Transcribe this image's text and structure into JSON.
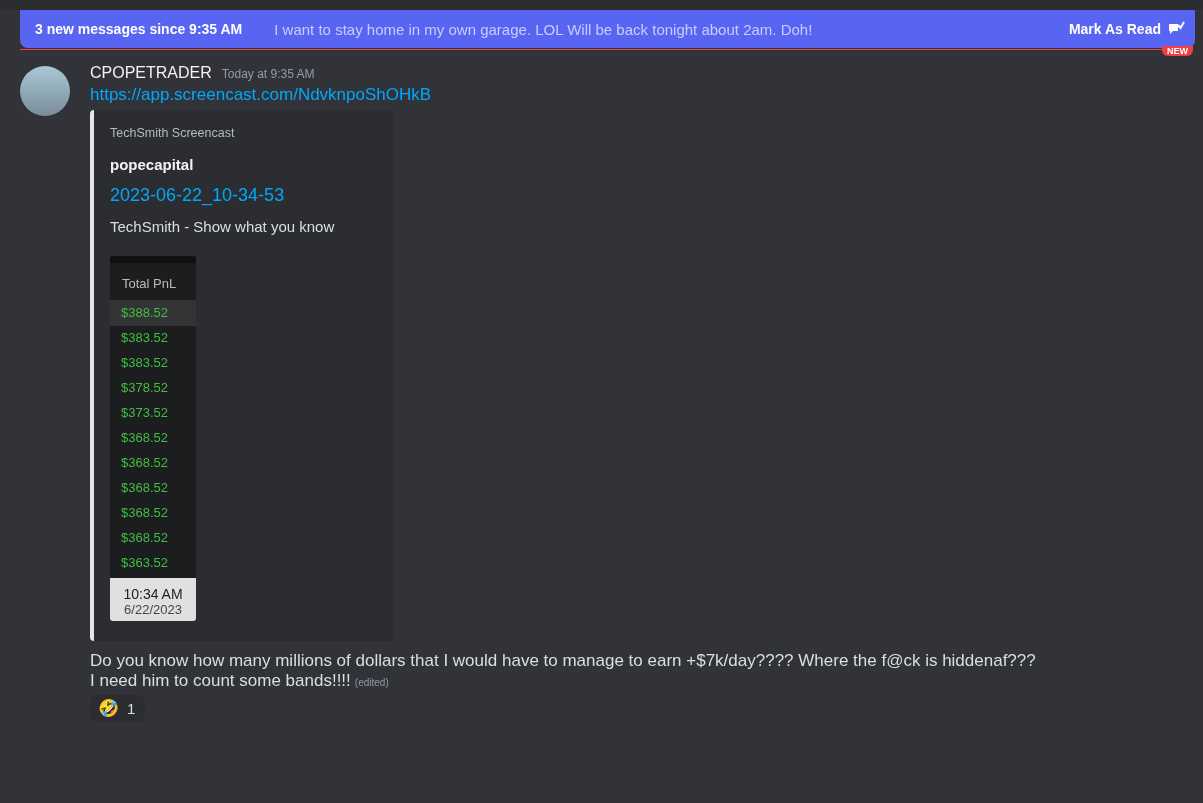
{
  "banner": {
    "text": "3 new messages since 9:35 AM",
    "hidden_message": "I want to stay home in my own garage.   LOL Will be back tonight about 2am.  Doh!",
    "action": "Mark As Read"
  },
  "divider": {
    "badge": "NEW"
  },
  "message": {
    "author": "CPOPETRADER",
    "timestamp": "Today at 9:35 AM",
    "link": "https://app.screencast.com/NdvknpoShOHkB",
    "embed": {
      "provider": "TechSmith Screencast",
      "author": "popecapital",
      "title": "2023-06-22_10-34-53",
      "description": "TechSmith - Show what you know",
      "thumbnail": {
        "column": "Total PnL",
        "rows": [
          {
            "value": "$388.52",
            "selected": true
          },
          {
            "value": "$383.52",
            "selected": false
          },
          {
            "value": "$383.52",
            "selected": false
          },
          {
            "value": "$378.52",
            "selected": false
          },
          {
            "value": "$373.52",
            "selected": false
          },
          {
            "value": "$368.52",
            "selected": false
          },
          {
            "value": "$368.52",
            "selected": false
          },
          {
            "value": "$368.52",
            "selected": false
          },
          {
            "value": "$368.52",
            "selected": false
          },
          {
            "value": "$368.52",
            "selected": false
          },
          {
            "value": "$363.52",
            "selected": false
          }
        ],
        "time": "10:34 AM",
        "date": "6/22/2023"
      }
    },
    "lines": [
      "Do you know how many millions of dollars that I would have to manage to earn +$7k/day????  Where the f@ck is hiddenaf???",
      "I need him to count some bands!!!!"
    ],
    "edited": "(edited)",
    "reactions": [
      {
        "emoji": "🤣",
        "count": "1"
      }
    ]
  }
}
